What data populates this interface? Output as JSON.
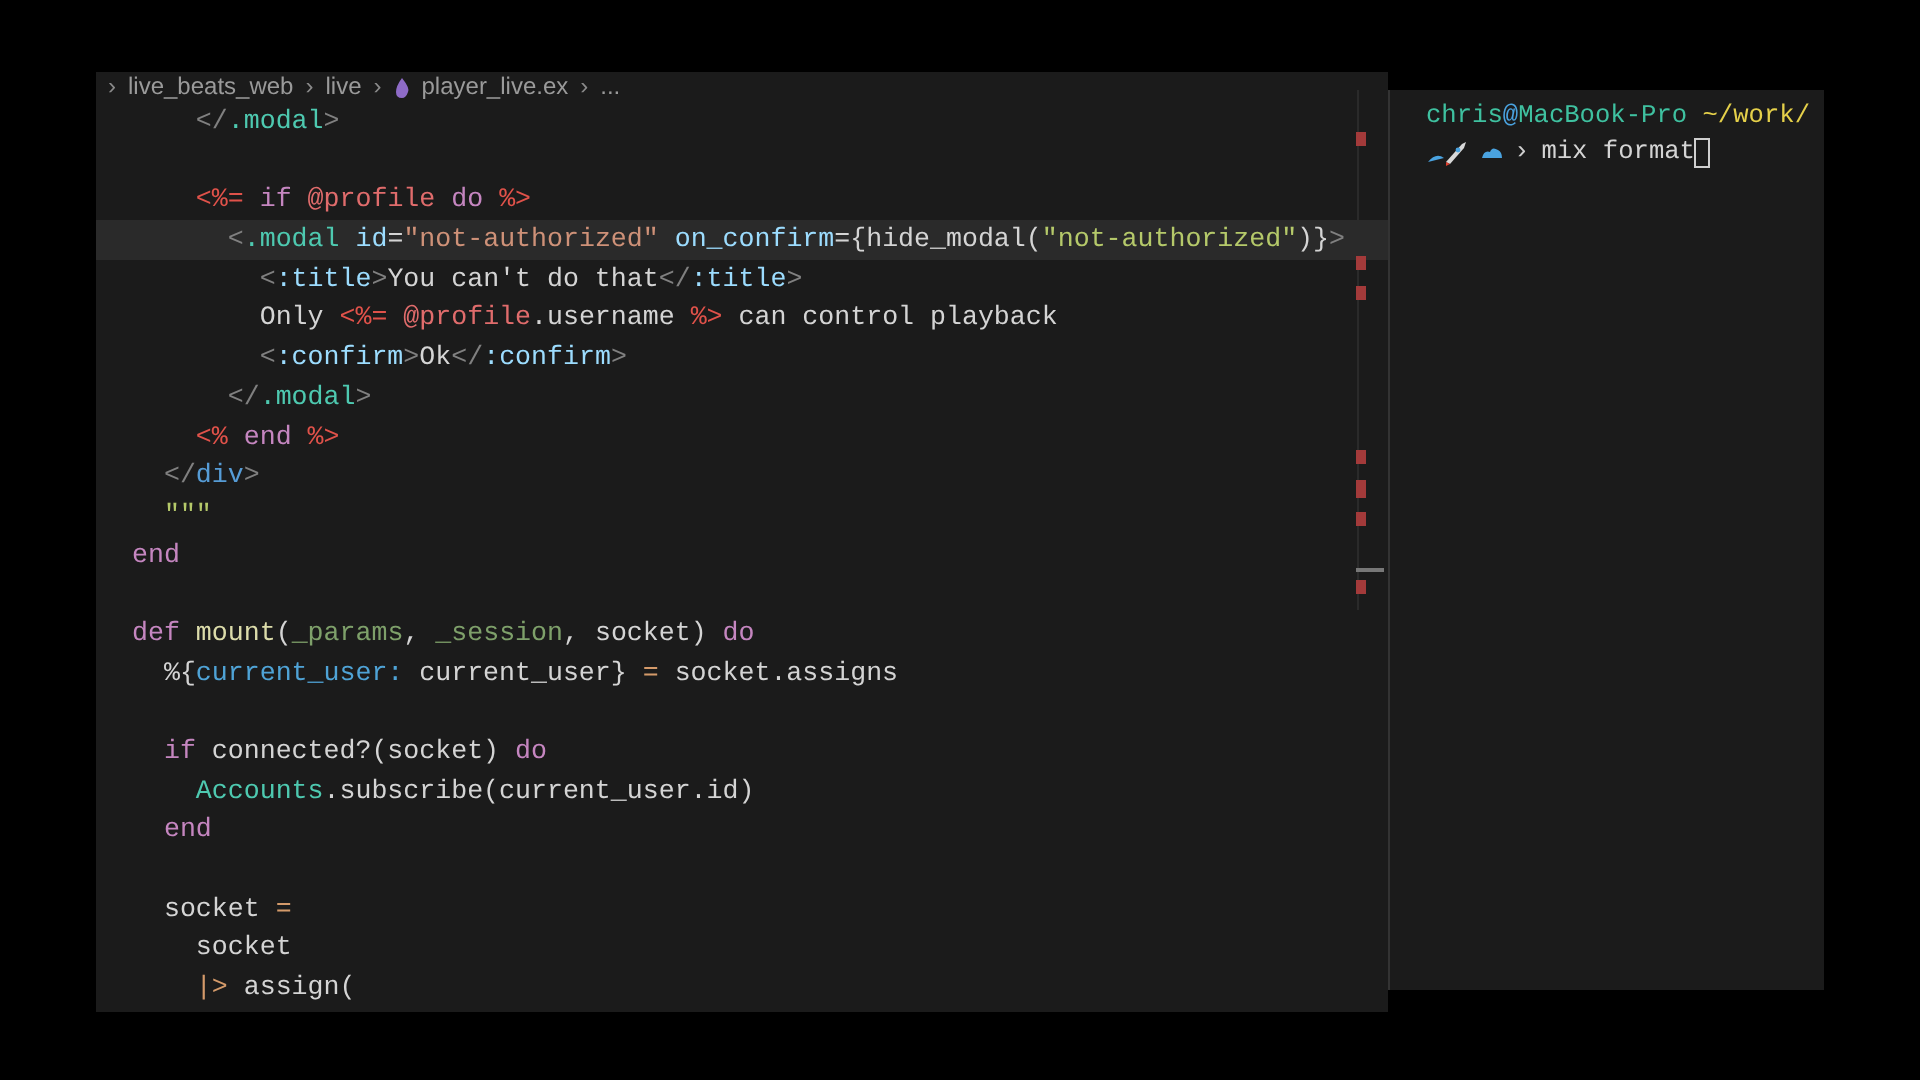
{
  "breadcrumb": [
    {
      "text": "›",
      "kind": "sep"
    },
    {
      "text": "live_beats_web",
      "kind": "part"
    },
    {
      "text": "›",
      "kind": "sep"
    },
    {
      "text": "live",
      "kind": "part"
    },
    {
      "text": "›",
      "kind": "sep"
    },
    {
      "text": "player_live.ex",
      "kind": "file"
    },
    {
      "text": "›",
      "kind": "sep"
    },
    {
      "text": "...",
      "kind": "part"
    }
  ],
  "editor": {
    "lines": [
      {
        "kind": "code",
        "current": false,
        "tokens": [
          {
            "kind": "punct",
            "text": "    </"
          },
          {
            "kind": "tag",
            "text": ".modal"
          },
          {
            "kind": "punct",
            "text": ">"
          }
        ]
      },
      {
        "kind": "blank"
      },
      {
        "kind": "code",
        "current": false,
        "tokens": [
          {
            "kind": "erb",
            "text": "    <%="
          },
          {
            "kind": "keyword",
            "text": " if"
          },
          {
            "kind": "assign",
            "text": " @profile"
          },
          {
            "kind": "keyword",
            "text": " do"
          },
          {
            "kind": "erb",
            "text": " %>"
          }
        ]
      },
      {
        "kind": "code",
        "current": true,
        "tokens": [
          {
            "kind": "punct",
            "text": "      <"
          },
          {
            "kind": "tag",
            "text": ".modal"
          },
          {
            "kind": "attr",
            "text": " id"
          },
          {
            "kind": "plain",
            "text": "="
          },
          {
            "kind": "string",
            "text": "\"not-authorized\""
          },
          {
            "kind": "attr",
            "text": " on_confirm"
          },
          {
            "kind": "plain",
            "text": "={hide_modal("
          },
          {
            "kind": "string2",
            "text": "\"not-authorized\""
          },
          {
            "kind": "plain",
            "text": ")}"
          },
          {
            "kind": "punct",
            "text": ">"
          }
        ]
      },
      {
        "kind": "code",
        "current": false,
        "tokens": [
          {
            "kind": "punct",
            "text": "        <"
          },
          {
            "kind": "attr",
            "text": ":title"
          },
          {
            "kind": "punct",
            "text": ">"
          },
          {
            "kind": "plain",
            "text": "You can't do that"
          },
          {
            "kind": "punct",
            "text": "</"
          },
          {
            "kind": "attr",
            "text": ":title"
          },
          {
            "kind": "punct",
            "text": ">"
          }
        ]
      },
      {
        "kind": "code",
        "current": false,
        "tokens": [
          {
            "kind": "plain",
            "text": "        Only "
          },
          {
            "kind": "erb",
            "text": "<%="
          },
          {
            "kind": "assign",
            "text": " @profile"
          },
          {
            "kind": "plain",
            "text": ".username "
          },
          {
            "kind": "erb",
            "text": "%>"
          },
          {
            "kind": "plain",
            "text": " can control playback"
          }
        ]
      },
      {
        "kind": "code",
        "current": false,
        "tokens": [
          {
            "kind": "punct",
            "text": "        <"
          },
          {
            "kind": "attr",
            "text": ":confirm"
          },
          {
            "kind": "punct",
            "text": ">"
          },
          {
            "kind": "plain",
            "text": "Ok"
          },
          {
            "kind": "punct",
            "text": "</"
          },
          {
            "kind": "attr",
            "text": ":confirm"
          },
          {
            "kind": "punct",
            "text": ">"
          }
        ]
      },
      {
        "kind": "code",
        "current": false,
        "tokens": [
          {
            "kind": "punct",
            "text": "      </"
          },
          {
            "kind": "tag",
            "text": ".modal"
          },
          {
            "kind": "punct",
            "text": ">"
          }
        ]
      },
      {
        "kind": "code",
        "current": false,
        "tokens": [
          {
            "kind": "erb",
            "text": "    <%"
          },
          {
            "kind": "keyword",
            "text": " end"
          },
          {
            "kind": "erb",
            "text": " %>"
          }
        ]
      },
      {
        "kind": "code",
        "current": false,
        "tokens": [
          {
            "kind": "punct",
            "text": "  </"
          },
          {
            "kind": "html",
            "text": "div"
          },
          {
            "kind": "punct",
            "text": ">"
          }
        ]
      },
      {
        "kind": "code",
        "current": false,
        "tokens": [
          {
            "kind": "heredoc",
            "text": "  \"\"\""
          }
        ]
      },
      {
        "kind": "code",
        "current": false,
        "tokens": [
          {
            "kind": "keyword",
            "text": "end"
          }
        ]
      },
      {
        "kind": "blank"
      },
      {
        "kind": "code",
        "current": false,
        "tokens": [
          {
            "kind": "keyword",
            "text": "def"
          },
          {
            "kind": "func",
            "text": " mount"
          },
          {
            "kind": "plain",
            "text": "("
          },
          {
            "kind": "param",
            "text": "_params"
          },
          {
            "kind": "plain",
            "text": ", "
          },
          {
            "kind": "param",
            "text": "_session"
          },
          {
            "kind": "plain",
            "text": ", socket) "
          },
          {
            "kind": "keyword",
            "text": "do"
          }
        ]
      },
      {
        "kind": "code",
        "current": false,
        "tokens": [
          {
            "kind": "plain",
            "text": "  %{"
          },
          {
            "kind": "key",
            "text": "current_user:"
          },
          {
            "kind": "plain",
            "text": " current_user} "
          },
          {
            "kind": "op",
            "text": "="
          },
          {
            "kind": "plain",
            "text": " socket.assigns"
          }
        ]
      },
      {
        "kind": "blank"
      },
      {
        "kind": "code",
        "current": false,
        "tokens": [
          {
            "kind": "keyword",
            "text": "  if"
          },
          {
            "kind": "plain",
            "text": " connected?(socket) "
          },
          {
            "kind": "keyword",
            "text": "do"
          }
        ]
      },
      {
        "kind": "code",
        "current": false,
        "tokens": [
          {
            "kind": "module",
            "text": "    Accounts"
          },
          {
            "kind": "plain",
            "text": ".subscribe(current_user.id)"
          }
        ]
      },
      {
        "kind": "code",
        "current": false,
        "tokens": [
          {
            "kind": "keyword",
            "text": "  end"
          }
        ]
      },
      {
        "kind": "blank"
      },
      {
        "kind": "code",
        "current": false,
        "tokens": [
          {
            "kind": "plain",
            "text": "  socket "
          },
          {
            "kind": "op",
            "text": "="
          }
        ]
      },
      {
        "kind": "code",
        "current": false,
        "tokens": [
          {
            "kind": "plain",
            "text": "    socket"
          }
        ]
      },
      {
        "kind": "code",
        "current": false,
        "tokens": [
          {
            "kind": "op",
            "text": "    |>"
          },
          {
            "kind": "plain",
            "text": " assign("
          }
        ]
      }
    ]
  },
  "terminal": {
    "prompt": [
      {
        "kind": "user",
        "text": "chris"
      },
      {
        "kind": "at",
        "text": "@"
      },
      {
        "kind": "host",
        "text": "MacBook-Pro"
      },
      {
        "kind": "path",
        "text": " ~/work/"
      }
    ],
    "chevron": "›",
    "command": "mix format"
  }
}
